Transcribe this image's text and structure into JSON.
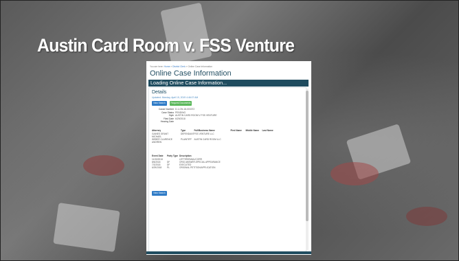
{
  "slide": {
    "title": "Austin Card Room v. FSS Venture"
  },
  "breadcrumb": {
    "prefix": "You are here:",
    "items": [
      "Home",
      "District Clerk",
      "Online Case Information"
    ]
  },
  "page": {
    "heading": "Online Case Information",
    "loading_banner": "Loading Online Case Information..."
  },
  "details": {
    "heading": "Details",
    "updated": "Updated: Monday, April 15, 2019 4:46:07 AM",
    "buttons": {
      "new_search": "New Search",
      "request_documents": "Request Documents"
    },
    "fields": [
      {
        "label": "Cause Number",
        "value": "D-1-GN-18-003372"
      },
      {
        "label": "Case Status",
        "value": "PENDING"
      },
      {
        "label": "Style",
        "value": "AUSTIN CARD ROOM V FSS VENTURE"
      },
      {
        "label": "Filed Date",
        "value": "6/29/2018"
      },
      {
        "label": "Hearing Date",
        "value": ""
      }
    ]
  },
  "parties": {
    "headers": [
      "Attorney",
      "Type",
      "Full/Business Name",
      "First Name",
      "Middle Name",
      "Last Name"
    ],
    "rows": [
      {
        "attorney_line1": "GAINES GRANT",
        "attorney_line2": "MICHAEL",
        "type": "DEFENDANT",
        "name": "FSS VENTURE LLC"
      },
      {
        "attorney_line1": "WEBER CLARENCE",
        "attorney_line2": "ANDREW",
        "type": "PLAINTIFF",
        "name": "AUSTIN CARD ROOM LLC"
      }
    ]
  },
  "events": {
    "headers": [
      "Event Date",
      "Party Type",
      "Description"
    ],
    "rows": [
      {
        "date": "11/30/2018",
        "party": "",
        "desc": "LETTER/EMAIL/CORR"
      },
      {
        "date": "8/6/2018",
        "party": "DF",
        "desc": "ORIG ANSWER-SPECIAL APPEARANCE"
      },
      {
        "date": "7/2/2018",
        "party": "DF",
        "desc": "EXECUTED"
      },
      {
        "date": "6/29/2018",
        "party": "PL",
        "desc": "ORIGINAL PETITION/APPLICATION"
      }
    ]
  },
  "footer_button": "New Search",
  "colors": {
    "header_bar": "#1f4c5f",
    "btn_blue": "#2f7bc6",
    "btn_green": "#5cb85c",
    "heading": "#244f63"
  }
}
